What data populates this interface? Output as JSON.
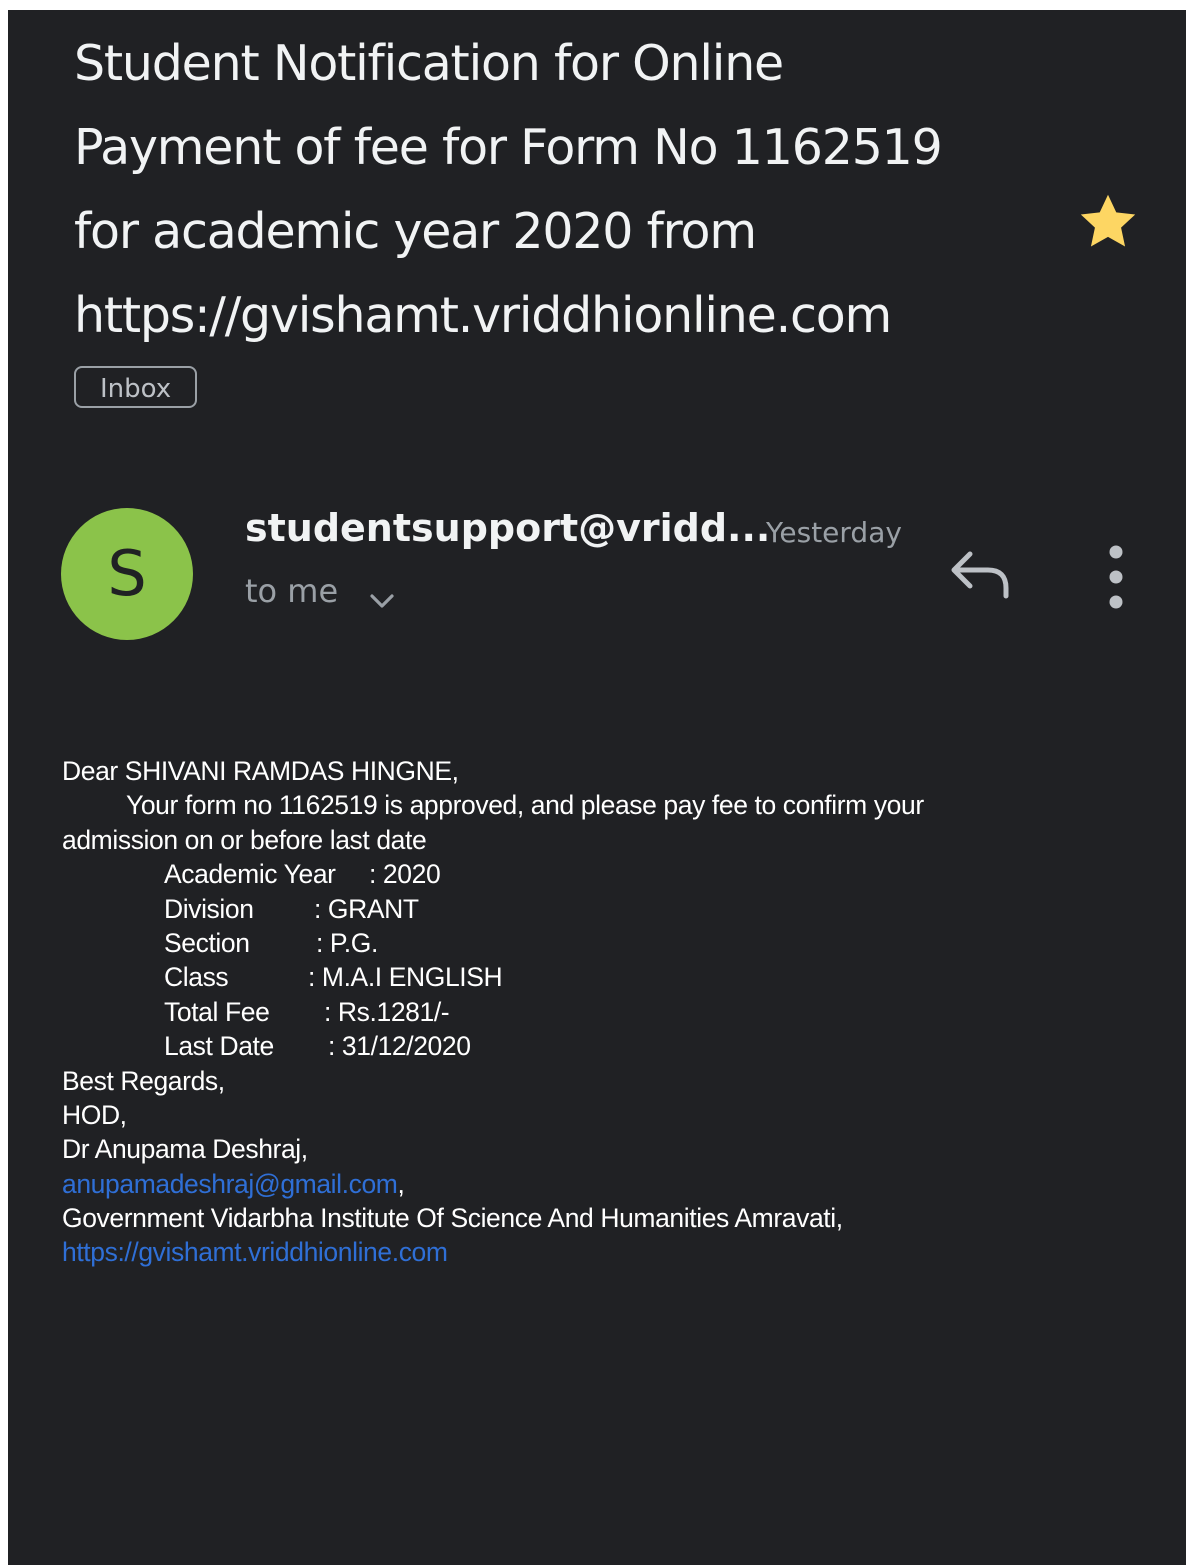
{
  "email": {
    "subject_lines": [
      "Student Notification for Online",
      "Payment of fee for Form No  1162519",
      "for academic year 2020 from",
      "https://gvishamt.vriddhionline.com"
    ],
    "label": "Inbox",
    "starred": true,
    "sender": {
      "initial": "S",
      "address": "studentsupport@vridd...",
      "time": "Yesterday",
      "recipient": "to me",
      "avatar_color": "#8bc34a"
    }
  },
  "body": {
    "greeting": "Dear SHIVANI RAMDAS HINGNE,",
    "line1": "Your form no 1162519 is approved, and please pay fee to confirm your",
    "line2": "admission on or before last date",
    "details": [
      {
        "key": "Academic Year",
        "value": ": 2020"
      },
      {
        "key": "Division",
        "value": ": GRANT"
      },
      {
        "key": "Section",
        "value": ": P.G."
      },
      {
        "key": "Class",
        "value": ": M.A.I ENGLISH"
      },
      {
        "key": "Total Fee",
        "value": ": Rs.1281/-"
      },
      {
        "key": "Last Date",
        "value": ": 31/12/2020"
      }
    ],
    "closing": "Best Regards,",
    "role": "HOD,",
    "name": "Dr Anupama Deshraj,",
    "email_link": "anupamadeshraj@gmail.com",
    "email_suffix": ",",
    "institute": "Government Vidarbha Institute Of Science And Humanities Amravati,",
    "website_link": "https://gvishamt.vriddhionline.com"
  },
  "colors": {
    "background": "#202124",
    "link": "#2f6fd6",
    "star": "#fdd663"
  }
}
